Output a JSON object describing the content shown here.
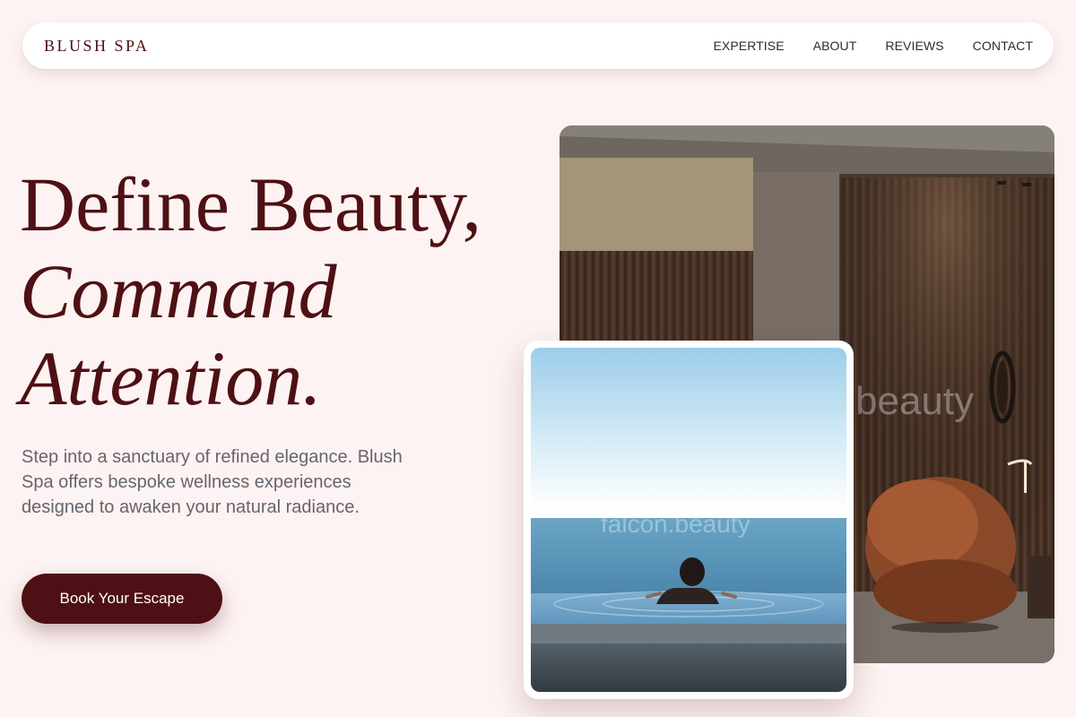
{
  "nav": {
    "brand": "BLUSH SPA",
    "links": [
      "EXPERTISE",
      "ABOUT",
      "REVIEWS",
      "CONTACT"
    ]
  },
  "hero": {
    "line1": "Define Beauty,",
    "line2": "Command",
    "line3": "Attention.",
    "lead": "Step into a sanctuary of refined elegance. Blush Spa offers bespoke wellness experiences designed to awaken your natural radiance.",
    "cta": "Book Your Escape"
  },
  "images": {
    "interior_watermark": "beauty",
    "pool_watermark": "falcon.beauty"
  },
  "colors": {
    "background": "#fdf3f2",
    "accent": "#4e1014",
    "text_muted": "#66656d"
  }
}
